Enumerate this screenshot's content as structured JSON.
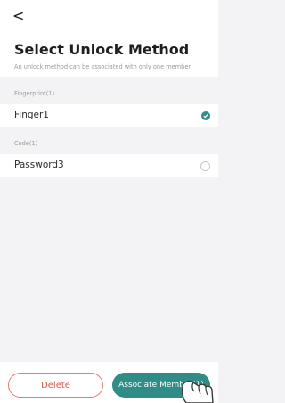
{
  "header": {
    "back_icon": "chevron-left",
    "title": "Select Unlock Method",
    "subtitle": "An unlock method can be associated with only one member."
  },
  "sections": [
    {
      "label": "Fingerprint(1)",
      "items": [
        {
          "label": "Finger1",
          "selected": true
        }
      ]
    },
    {
      "label": "Code(1)",
      "items": [
        {
          "label": "Password3",
          "selected": false
        }
      ]
    }
  ],
  "footer": {
    "delete_label": "Delete",
    "associate_label": "Associate Member(1)"
  },
  "colors": {
    "accent": "#2f8c86",
    "danger": "#d9564c",
    "background": "#f3f3f5"
  }
}
